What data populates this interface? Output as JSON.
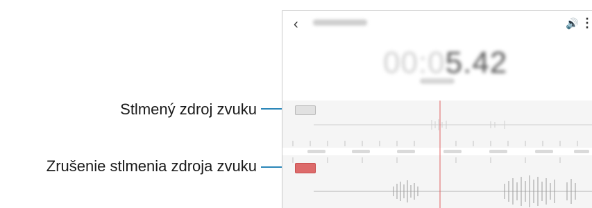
{
  "callouts": {
    "muted_label": "Stlmený zdroj zvuku",
    "unmute_label": "Zrušenie stlmenia zdroja zvuku"
  },
  "screen": {
    "timer_dim": "00:0",
    "timer_bold": "5.42"
  },
  "icons": {
    "back": "chevron-left-icon",
    "volume": "speaker-icon",
    "more": "more-vertical-icon"
  },
  "colors": {
    "leader_line": "#2a86b8",
    "playhead": "#e06060",
    "unmute_button": "#dd6b6b",
    "muted_button": "#e1e1e1"
  }
}
